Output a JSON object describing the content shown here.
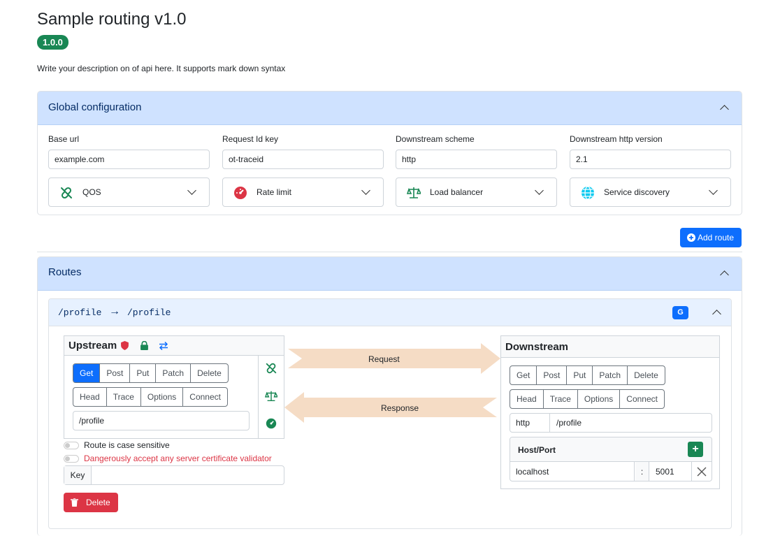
{
  "title": "Sample routing v1.0",
  "version": "1.0.0",
  "description": "Write your description on of api here. It supports mark down syntax",
  "global": {
    "header": "Global configuration",
    "base_url_label": "Base url",
    "base_url_value": "example.com",
    "request_id_label": "Request Id key",
    "request_id_value": "ot-traceid",
    "scheme_label": "Downstream scheme",
    "scheme_value": "http",
    "http_version_label": "Downstream http version",
    "http_version_value": "2.1",
    "qos": "QOS",
    "rate_limit": "Rate limit",
    "load_balancer": "Load balancer",
    "service_discovery": "Service discovery"
  },
  "add_route": "Add route",
  "routes": {
    "header": "Routes",
    "route": {
      "upstream_path": "/profile",
      "arrow": "→",
      "downstream_path": "/profile",
      "badge": "G",
      "upstream": {
        "title": "Upstream",
        "methods_row1": [
          "Get",
          "Post",
          "Put",
          "Patch",
          "Delete"
        ],
        "methods_row2": [
          "Head",
          "Trace",
          "Options",
          "Connect"
        ],
        "selected": "Get",
        "path": "/profile"
      },
      "request_label": "Request",
      "response_label": "Response",
      "downstream": {
        "title": "Downstream",
        "methods_row1": [
          "Get",
          "Post",
          "Put",
          "Patch",
          "Delete"
        ],
        "methods_row2": [
          "Head",
          "Trace",
          "Options",
          "Connect"
        ],
        "scheme": "http",
        "path": "/profile",
        "hostport_title": "Host/Port",
        "host": "localhost",
        "colon": ":",
        "port": "5001",
        "add": "+"
      },
      "case_sensitive": "Route is case sensitive",
      "danger": "Dangerously accept any server certificate validator",
      "key_label": "Key",
      "delete": "Delete"
    }
  },
  "colors": {
    "primary": "#0d6efd",
    "success": "#198754",
    "danger": "#dc3545",
    "header_bg": "#cfe2ff",
    "arrow_fill": "#f5dcc5"
  }
}
